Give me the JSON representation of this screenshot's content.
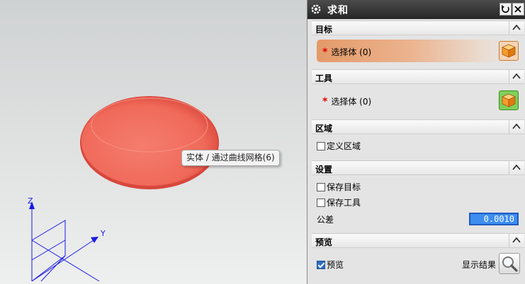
{
  "tooltip": "实体 / 通过曲线网格(6)",
  "triad": {
    "z": "Z",
    "y": "Y"
  },
  "dialog": {
    "title": "求和",
    "sections": {
      "target": {
        "label": "目标",
        "select_label": "选择体 (0)",
        "required_mark": "*"
      },
      "tool": {
        "label": "工具",
        "select_label": "选择体 (0)",
        "required_mark": "*"
      },
      "region": {
        "label": "区域",
        "define_region": "定义区域",
        "define_region_checked": false
      },
      "settings": {
        "label": "设置",
        "keep_target": "保存目标",
        "keep_target_checked": false,
        "keep_tool": "保存工具",
        "keep_tool_checked": false,
        "tolerance_label": "公差",
        "tolerance_value": "0.0010"
      },
      "preview": {
        "label": "预览",
        "preview_label": "预览",
        "preview_checked": true,
        "show_result": "显示结果"
      }
    }
  },
  "colors": {
    "dome": "#f26a5a",
    "selected_row": "#e8a67c",
    "triad": "#1a1ae6",
    "titlebar": "#333333"
  }
}
